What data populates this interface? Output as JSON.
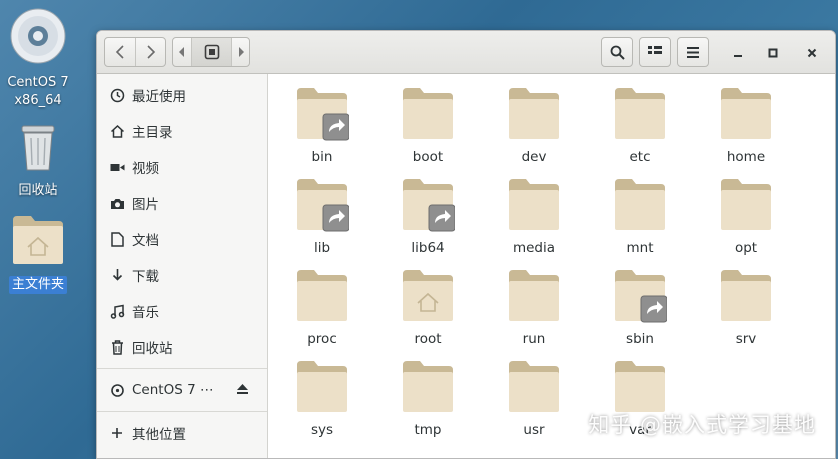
{
  "desktop": {
    "icons": [
      {
        "label": "CentOS 7\nx86_64",
        "icon": "disc-icon"
      },
      {
        "label": "回收站",
        "icon": "trash-icon"
      },
      {
        "label": "主文件夹",
        "icon": "home-folder-icon"
      }
    ]
  },
  "toolbar": {
    "back": "back-arrow-icon",
    "forward": "forward-arrow-icon",
    "path_prev": "path-prev-icon",
    "path_home": "home-path-icon",
    "path_next": "path-next-icon",
    "search": "search-icon",
    "view_toggle": "list-view-icon",
    "menu": "menu-icon",
    "minimize": "minimize-icon",
    "maximize": "maximize-icon",
    "close": "close-icon"
  },
  "sidebar": {
    "items": [
      {
        "label": "最近使用",
        "icon": "clock-icon"
      },
      {
        "label": "主目录",
        "icon": "home-icon"
      },
      {
        "label": "视频",
        "icon": "video-icon"
      },
      {
        "label": "图片",
        "icon": "camera-icon"
      },
      {
        "label": "文档",
        "icon": "document-icon"
      },
      {
        "label": "下载",
        "icon": "download-icon"
      },
      {
        "label": "音乐",
        "icon": "music-icon"
      },
      {
        "label": "回收站",
        "icon": "trash-icon"
      }
    ],
    "devices": [
      {
        "label": "CentOS 7 ⋯",
        "icon": "disc-icon",
        "action": "eject-icon"
      }
    ],
    "other": {
      "label": "其他位置",
      "icon": "plus-icon"
    }
  },
  "files": [
    {
      "name": "bin",
      "badge": "symlink"
    },
    {
      "name": "boot",
      "badge": ""
    },
    {
      "name": "dev",
      "badge": ""
    },
    {
      "name": "etc",
      "badge": ""
    },
    {
      "name": "home",
      "badge": ""
    },
    {
      "name": "lib",
      "badge": "symlink"
    },
    {
      "name": "lib64",
      "badge": "symlink"
    },
    {
      "name": "media",
      "badge": ""
    },
    {
      "name": "mnt",
      "badge": ""
    },
    {
      "name": "opt",
      "badge": ""
    },
    {
      "name": "proc",
      "badge": ""
    },
    {
      "name": "root",
      "badge": "home"
    },
    {
      "name": "run",
      "badge": ""
    },
    {
      "name": "sbin",
      "badge": "symlink"
    },
    {
      "name": "srv",
      "badge": ""
    },
    {
      "name": "sys",
      "badge": ""
    },
    {
      "name": "tmp",
      "badge": ""
    },
    {
      "name": "usr",
      "badge": ""
    },
    {
      "name": "var",
      "badge": ""
    }
  ],
  "watermark": "知乎 @嵌入式学习基地",
  "colors": {
    "folder_back": "#c9b995",
    "folder_front": "#ece0c8",
    "selection": "#3b7fd3"
  }
}
